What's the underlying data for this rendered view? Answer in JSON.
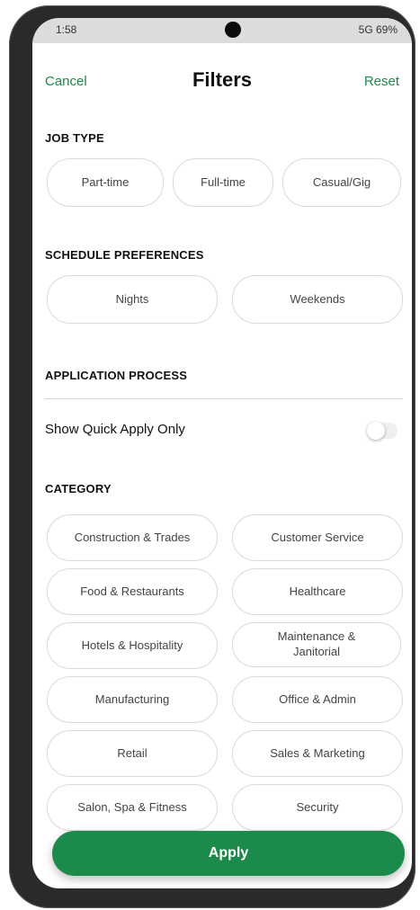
{
  "status_bar": {
    "time": "1:58",
    "right": "5G 69%"
  },
  "header": {
    "cancel": "Cancel",
    "title": "Filters",
    "reset": "Reset"
  },
  "job_type": {
    "label": "JOB TYPE",
    "options": [
      "Part-time",
      "Full-time",
      "Casual/Gig"
    ]
  },
  "schedule": {
    "label": "SCHEDULE PREFERENCES",
    "options": [
      "Nights",
      "Weekends"
    ]
  },
  "application": {
    "label": "APPLICATION PROCESS",
    "quick_apply_label": "Show Quick Apply Only",
    "quick_apply_on": false
  },
  "category": {
    "label": "CATEGORY",
    "options": [
      "Construction & Trades",
      "Customer Service",
      "Food & Restaurants",
      "Healthcare",
      "Hotels & Hospitality",
      "Maintenance & Janitorial",
      "Manufacturing",
      "Office & Admin",
      "Retail",
      "Sales & Marketing",
      "Salon, Spa & Fitness",
      "Security"
    ]
  },
  "apply_label": "Apply",
  "colors": {
    "accent": "#1c8a4b",
    "chip_border": "#d9d9d9"
  }
}
